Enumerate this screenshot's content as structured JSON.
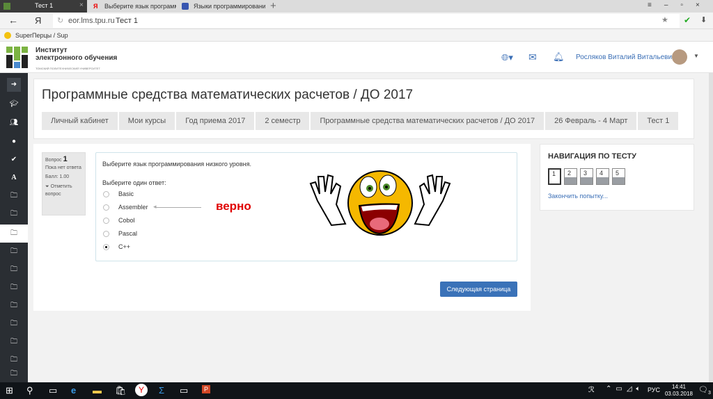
{
  "browser": {
    "tabs": [
      {
        "label": "Тест 1",
        "active": true
      },
      {
        "label": "Выберите язык программи"
      },
      {
        "label": "Языки программирования"
      }
    ],
    "new_tab": "+",
    "url_domain": "eor.lms.tpu.ru",
    "url_title": "Тест 1",
    "bookmark": "SuperПерцы / Sup"
  },
  "header": {
    "logo_line1": "Институт",
    "logo_line2": "электронного обучения",
    "logo_sub": "ТОМСКИЙ ПОЛИТЕХНИЧЕСКИЙ УНИВЕРСИТЕТ",
    "user": "Росляков Виталий Витальевич"
  },
  "page": {
    "title": "Программные средства математических расчетов / ДО 2017",
    "breadcrumbs": [
      "Личный кабинет",
      "Мои курсы",
      "Год приема 2017",
      "2 семестр",
      "Программные средства математических расчетов / ДО 2017",
      "26 Февраль - 4 Март",
      "Тест 1"
    ]
  },
  "question": {
    "label": "Вопрос",
    "number": "1",
    "status": "Пока нет ответа",
    "score": "Балл: 1.00",
    "flag": "Отметить вопрос",
    "text": "Выберите язык программирования низкого уровня.",
    "prompt": "Выберите один ответ:",
    "options": [
      "Basic",
      "Assembler",
      "Cobol",
      "Pascal",
      "C++"
    ],
    "selected": 4,
    "annotation": "верно",
    "annotation_color": "#e00000"
  },
  "next_button": "Следующая страница",
  "nav": {
    "title": "НАВИГАЦИЯ ПО ТЕСТУ",
    "buttons": [
      "1",
      "2",
      "3",
      "4",
      "5"
    ],
    "finish": "Закончить попытку..."
  },
  "taskbar": {
    "lang": "РУС",
    "time": "14:41",
    "date": "03.03.2018",
    "notifications": "3"
  }
}
